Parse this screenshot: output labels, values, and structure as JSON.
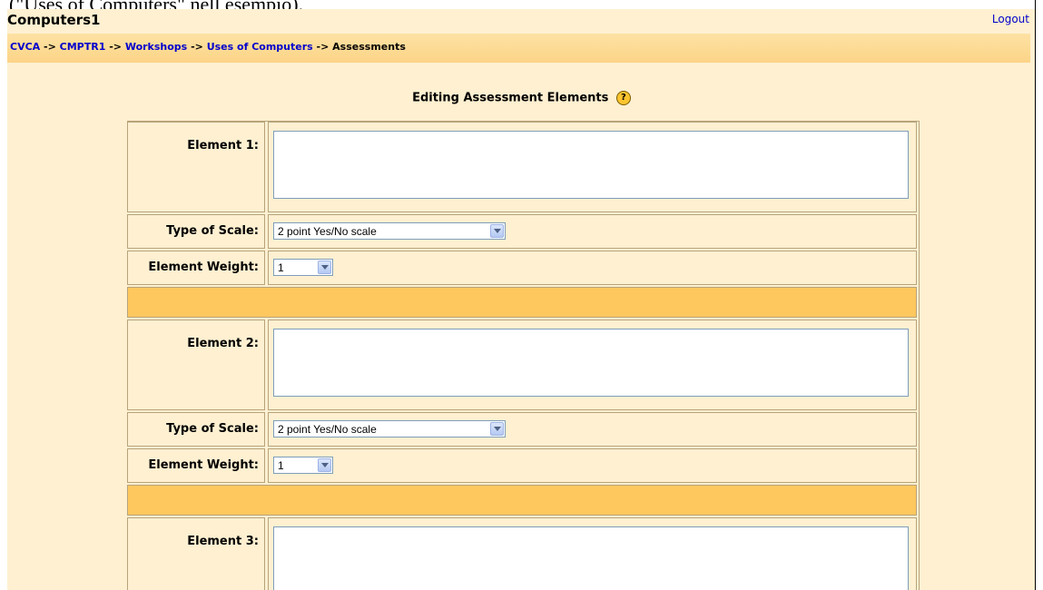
{
  "caption": "(\"Uses of Computers\" nell esempio).",
  "header": {
    "site_title": "Computers1",
    "logout_label": "Logout"
  },
  "breadcrumb": {
    "items": [
      "CVCA",
      "CMPTR1",
      "Workshops",
      "Uses of Computers",
      "Assessments"
    ],
    "separator": "->"
  },
  "page": {
    "heading": "Editing Assessment Elements",
    "help_glyph": "?"
  },
  "form": {
    "elements": [
      {
        "label": "Element 1:",
        "scale_label": "Type of Scale:",
        "scale_value": "2 point Yes/No scale",
        "weight_label": "Element Weight:",
        "weight_value": "1"
      },
      {
        "label": "Element 2:",
        "scale_label": "Type of Scale:",
        "scale_value": "2 point Yes/No scale",
        "weight_label": "Element Weight:",
        "weight_value": "1"
      },
      {
        "label": "Element 3:"
      }
    ]
  },
  "colors": {
    "page_bg": "#fef0d1",
    "navbar": "#fcd487",
    "separator": "#fec85f",
    "link": "#0000cc"
  }
}
